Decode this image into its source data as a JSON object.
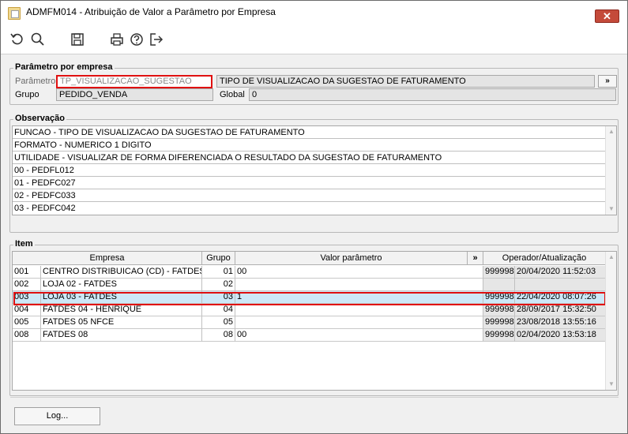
{
  "window": {
    "title": "ADMFM014 - Atribuição de Valor a Parâmetro por Empresa",
    "close_label": "✕"
  },
  "toolbar": {
    "icons": [
      "refresh-icon",
      "search-icon",
      "save-icon",
      "print-icon",
      "help-icon",
      "exit-icon"
    ]
  },
  "parametro": {
    "section_title": "Parâmetro por empresa",
    "parametro_label": "Parâmetro",
    "parametro_value": "TP_VISUALIZACAO_SUGESTAO",
    "descricao_value": "TIPO DE VISUALIZACAO DA SUGESTAO DE FATURAMENTO",
    "expand_label": "»",
    "grupo_label": "Grupo",
    "grupo_value": "PEDIDO_VENDA",
    "global_label": "Global",
    "global_value": "0"
  },
  "observacao": {
    "section_title": "Observação",
    "lines": [
      "FUNCAO - TIPO DE VISUALIZACAO DA SUGESTAO DE FATURAMENTO",
      "FORMATO - NUMERICO 1 DIGITO",
      "UTILIDADE - VISUALIZAR DE FORMA DIFERENCIADA O RESULTADO DA SUGESTAO DE FATURAMENTO",
      "00 - PEDFL012",
      "01 - PEDFC027",
      "02 - PEDFC033",
      "03 - PEDFC042"
    ]
  },
  "item": {
    "section_title": "Item",
    "columns": {
      "empresa": "Empresa",
      "grupo": "Grupo",
      "valor": "Valor parâmetro",
      "expand": "»",
      "operador": "Operador/Atualização"
    },
    "rows": [
      {
        "code": "001",
        "empresa": "CENTRO DISTRIBUICAO (CD) - FATDES",
        "grupo": "01",
        "valor": "00",
        "operador": "999998",
        "data": "20/04/2020 11:52:03"
      },
      {
        "code": "002",
        "empresa": "LOJA 02 - FATDES",
        "grupo": "02",
        "valor": "",
        "operador": "",
        "data": ""
      },
      {
        "code": "003",
        "empresa": "LOJA 03 - FATDES",
        "grupo": "03",
        "valor": "1",
        "operador": "999998",
        "data": "22/04/2020 08:07:26"
      },
      {
        "code": "004",
        "empresa": "FATDES 04 - HENRIQUE",
        "grupo": "04",
        "valor": "",
        "operador": "999998",
        "data": "28/09/2017 15:32:50"
      },
      {
        "code": "005",
        "empresa": "FATDES 05 NFCE",
        "grupo": "05",
        "valor": "",
        "operador": "999998",
        "data": "23/08/2018 13:55:16"
      },
      {
        "code": "008",
        "empresa": "FATDES 08",
        "grupo": "08",
        "valor": "00",
        "operador": "999998",
        "data": "02/04/2020 13:53:18"
      }
    ],
    "selected_row_index": 2
  },
  "footer": {
    "log_label": "Log..."
  }
}
